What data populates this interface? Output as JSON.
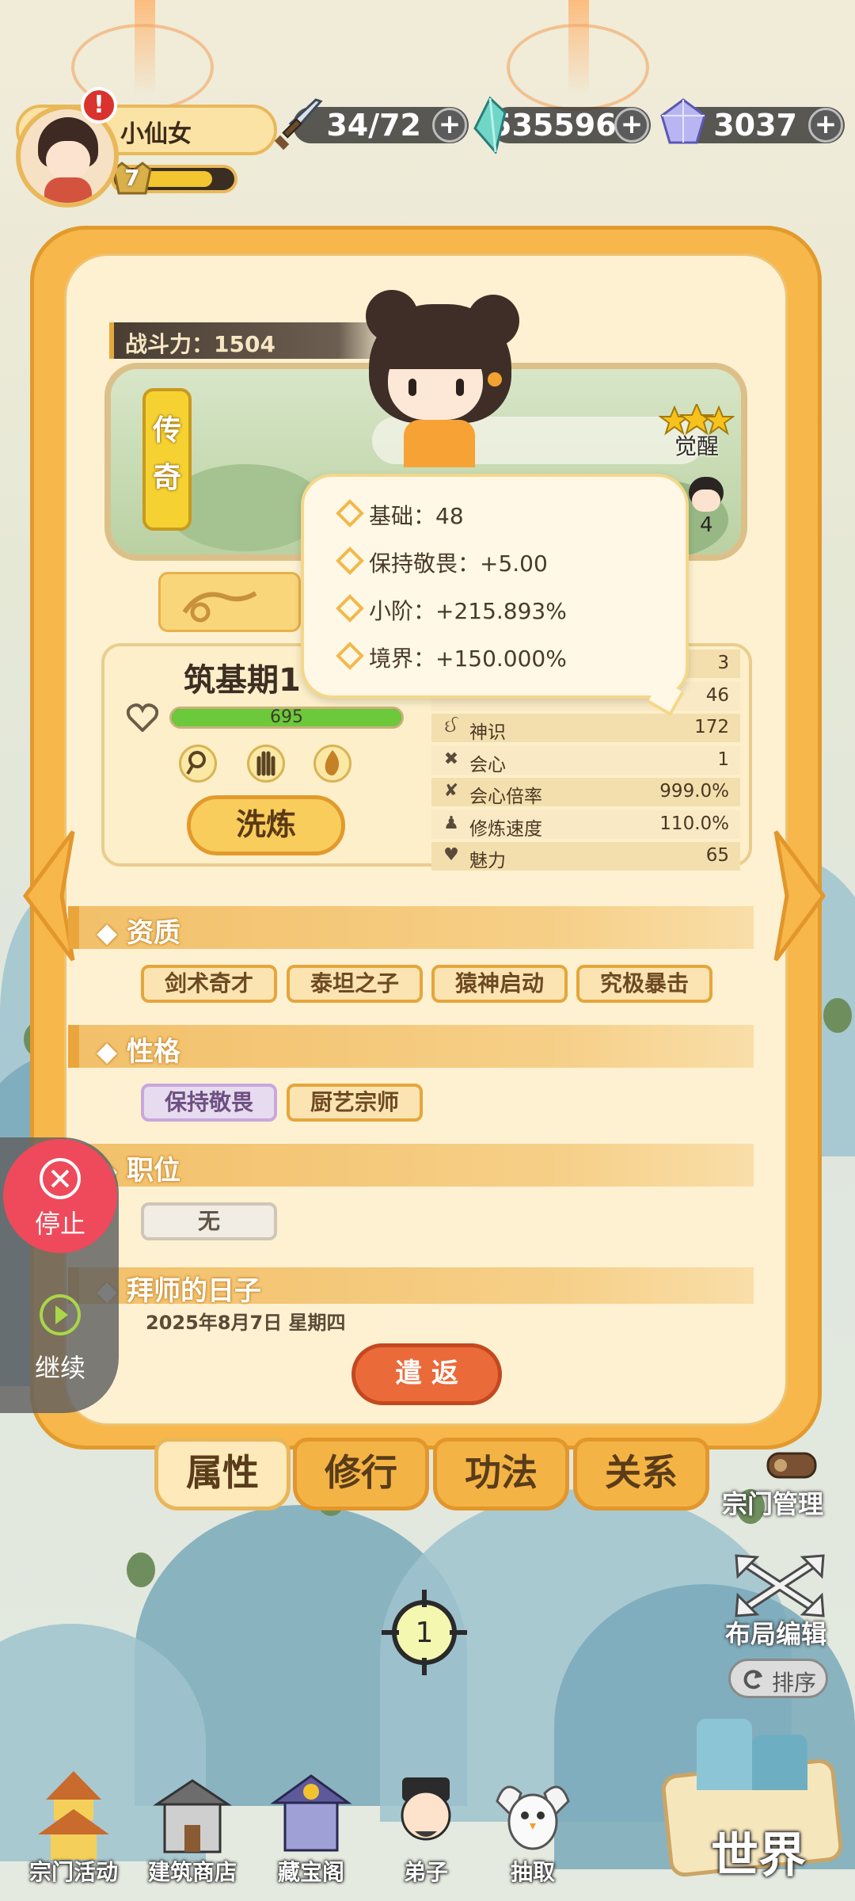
{
  "player": {
    "name": "小仙女",
    "level": "7",
    "alert": "!"
  },
  "resources": [
    {
      "icon": "sword-icon",
      "value": "34/72"
    },
    {
      "icon": "crystal-icon",
      "value": "535596"
    },
    {
      "icon": "gem-icon",
      "value": "3037"
    }
  ],
  "character": {
    "combat_power": "战斗力：1504",
    "rarity_label": "传\n奇",
    "rarity_char1": "传",
    "rarity_char2": "奇",
    "awaken_label": "觉醒",
    "awaken_number": "4",
    "realm": "筑基期1",
    "hp_value": "695",
    "hp_fill": 1.0,
    "refine_button": "洗炼"
  },
  "tooltip": {
    "lines": [
      "基础：48",
      "保持敬畏：+5.00",
      "小阶：+215.893%",
      "境界：+150.000%"
    ]
  },
  "stats": [
    {
      "icon": "dot",
      "label": "",
      "value": "3"
    },
    {
      "icon": "dot",
      "label": "",
      "value": "46"
    },
    {
      "icon": "spirit-icon",
      "label": "神识",
      "value": "172"
    },
    {
      "icon": "crit-icon",
      "label": "会心",
      "value": "1"
    },
    {
      "icon": "crit-rate-icon",
      "label": "会心倍率",
      "value": "999.0%"
    },
    {
      "icon": "cultivate-icon",
      "label": "修炼速度",
      "value": "110.0%"
    },
    {
      "icon": "charm-icon",
      "label": "魅力",
      "value": "65"
    }
  ],
  "sections": {
    "aptitude": {
      "title": "◆ 资质",
      "tags": [
        "剑术奇才",
        "泰坦之子",
        "猿神启动",
        "究极暴击"
      ]
    },
    "personality": {
      "title": "◆ 性格",
      "tags": [
        "保持敬畏",
        "厨艺宗师"
      ]
    },
    "position": {
      "title": "◆ 职位",
      "value": "无"
    },
    "apprentice_day": {
      "title": "◆ 拜师的日子",
      "date": "2025年8月7日 星期四"
    }
  },
  "dismiss_button": "遣 返",
  "tabs": [
    "属性",
    "修行",
    "功法",
    "关系"
  ],
  "float_controls": {
    "stop": "停止",
    "continue": "继续"
  },
  "right_controls": {
    "sect_manage": "宗门管理",
    "layout_edit": "布局编辑",
    "sort": "排序"
  },
  "target_marker": "1",
  "dock": [
    "宗门活动",
    "建筑商店",
    "藏宝阁",
    "弟子",
    "抽取"
  ],
  "world_label": "世界",
  "colors": {
    "panel": "#f7b74a",
    "accent": "#e6a63b",
    "hp_bar": "#6cc93b",
    "dismiss": "#ea6a3a",
    "stop": "#ee4a5b"
  }
}
